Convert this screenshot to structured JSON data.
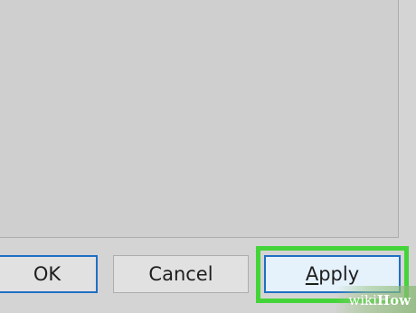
{
  "buttons": {
    "ok_label": "OK",
    "cancel_label": "Cancel",
    "apply_first": "A",
    "apply_rest": "pply"
  },
  "watermark": {
    "part1": "wiki",
    "part2": "How"
  },
  "colors": {
    "focus_border": "#1f6fc5",
    "highlight": "#44d43a",
    "apply_bg": "#e5f1fb"
  }
}
